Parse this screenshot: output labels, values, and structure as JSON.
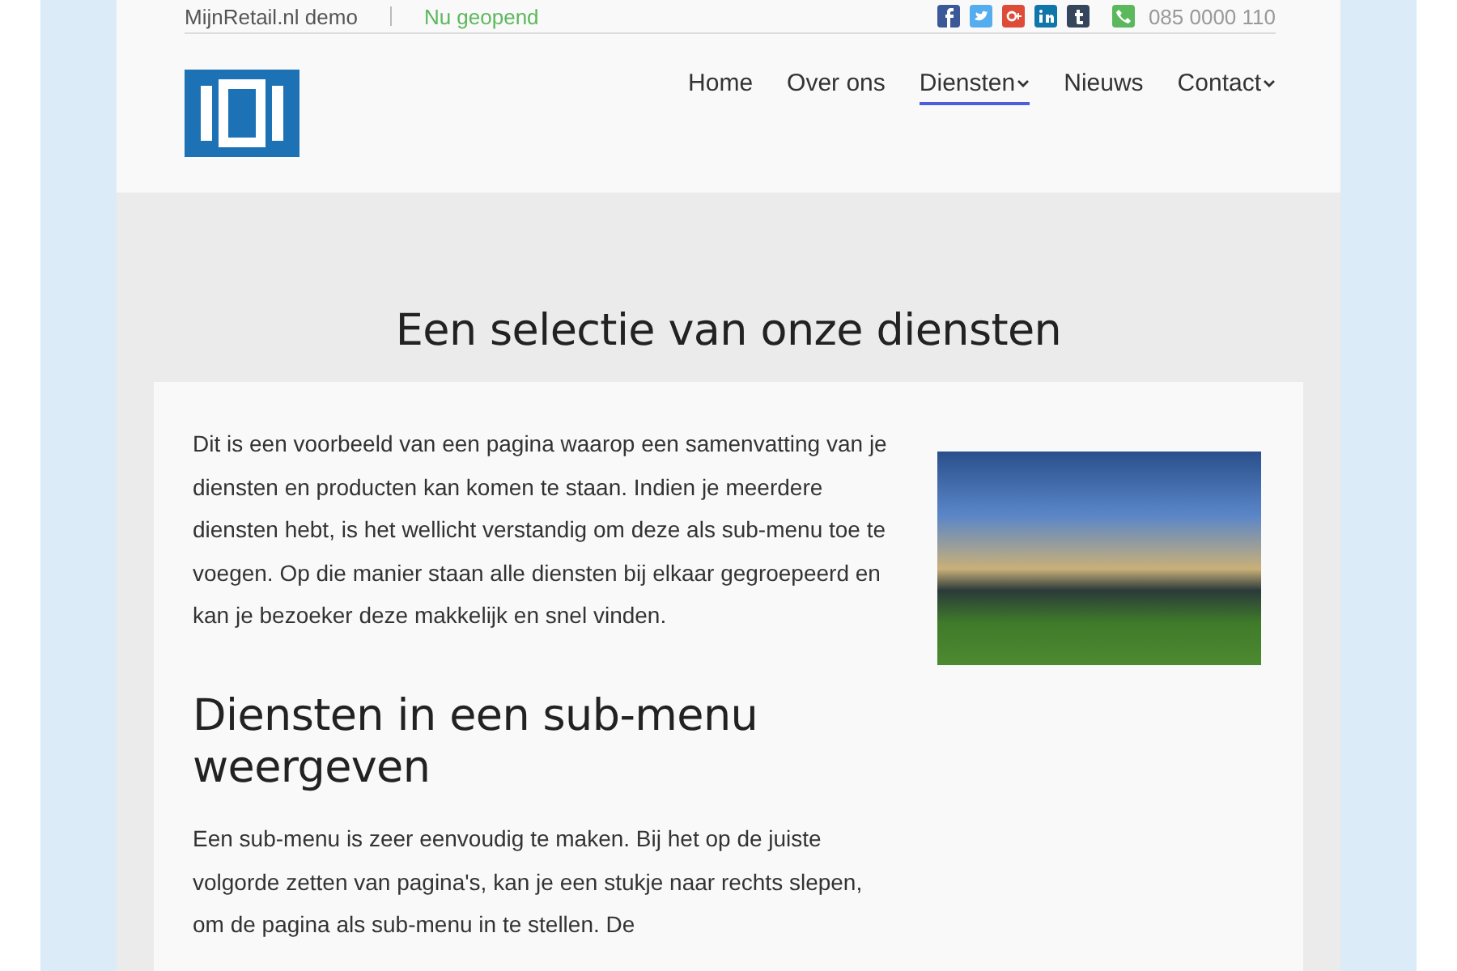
{
  "topbar": {
    "site_name": "MijnRetail.nl demo",
    "status": "Nu geopend",
    "phone": "085 0000 110"
  },
  "nav": [
    {
      "label": "Home",
      "selected": false,
      "has_submenu": false
    },
    {
      "label": "Over ons",
      "selected": false,
      "has_submenu": false
    },
    {
      "label": "Diensten",
      "selected": true,
      "has_submenu": true
    },
    {
      "label": "Nieuws",
      "selected": false,
      "has_submenu": false
    },
    {
      "label": "Contact",
      "selected": false,
      "has_submenu": true
    }
  ],
  "page_title": "Een selectie van onze diensten",
  "intro": "Dit is een voorbeeld van een pagina waarop een samenvatting van je diensten en producten kan komen te staan. Indien je meerdere diensten hebt, is het wellicht verstandig om deze als sub-menu toe te voegen. Op die manier staan alle diensten bij elkaar gegroepeerd en kan je bezoeker deze makkelijk en snel vinden.",
  "section_heading": "Diensten in een sub-menu weergeven",
  "section_text": "Een sub-menu is zeer eenvoudig te maken. Bij het op de juiste volgorde zetten van pagina's, kan je een stukje naar rechts slepen, om de pagina als sub-menu in te stellen. De"
}
